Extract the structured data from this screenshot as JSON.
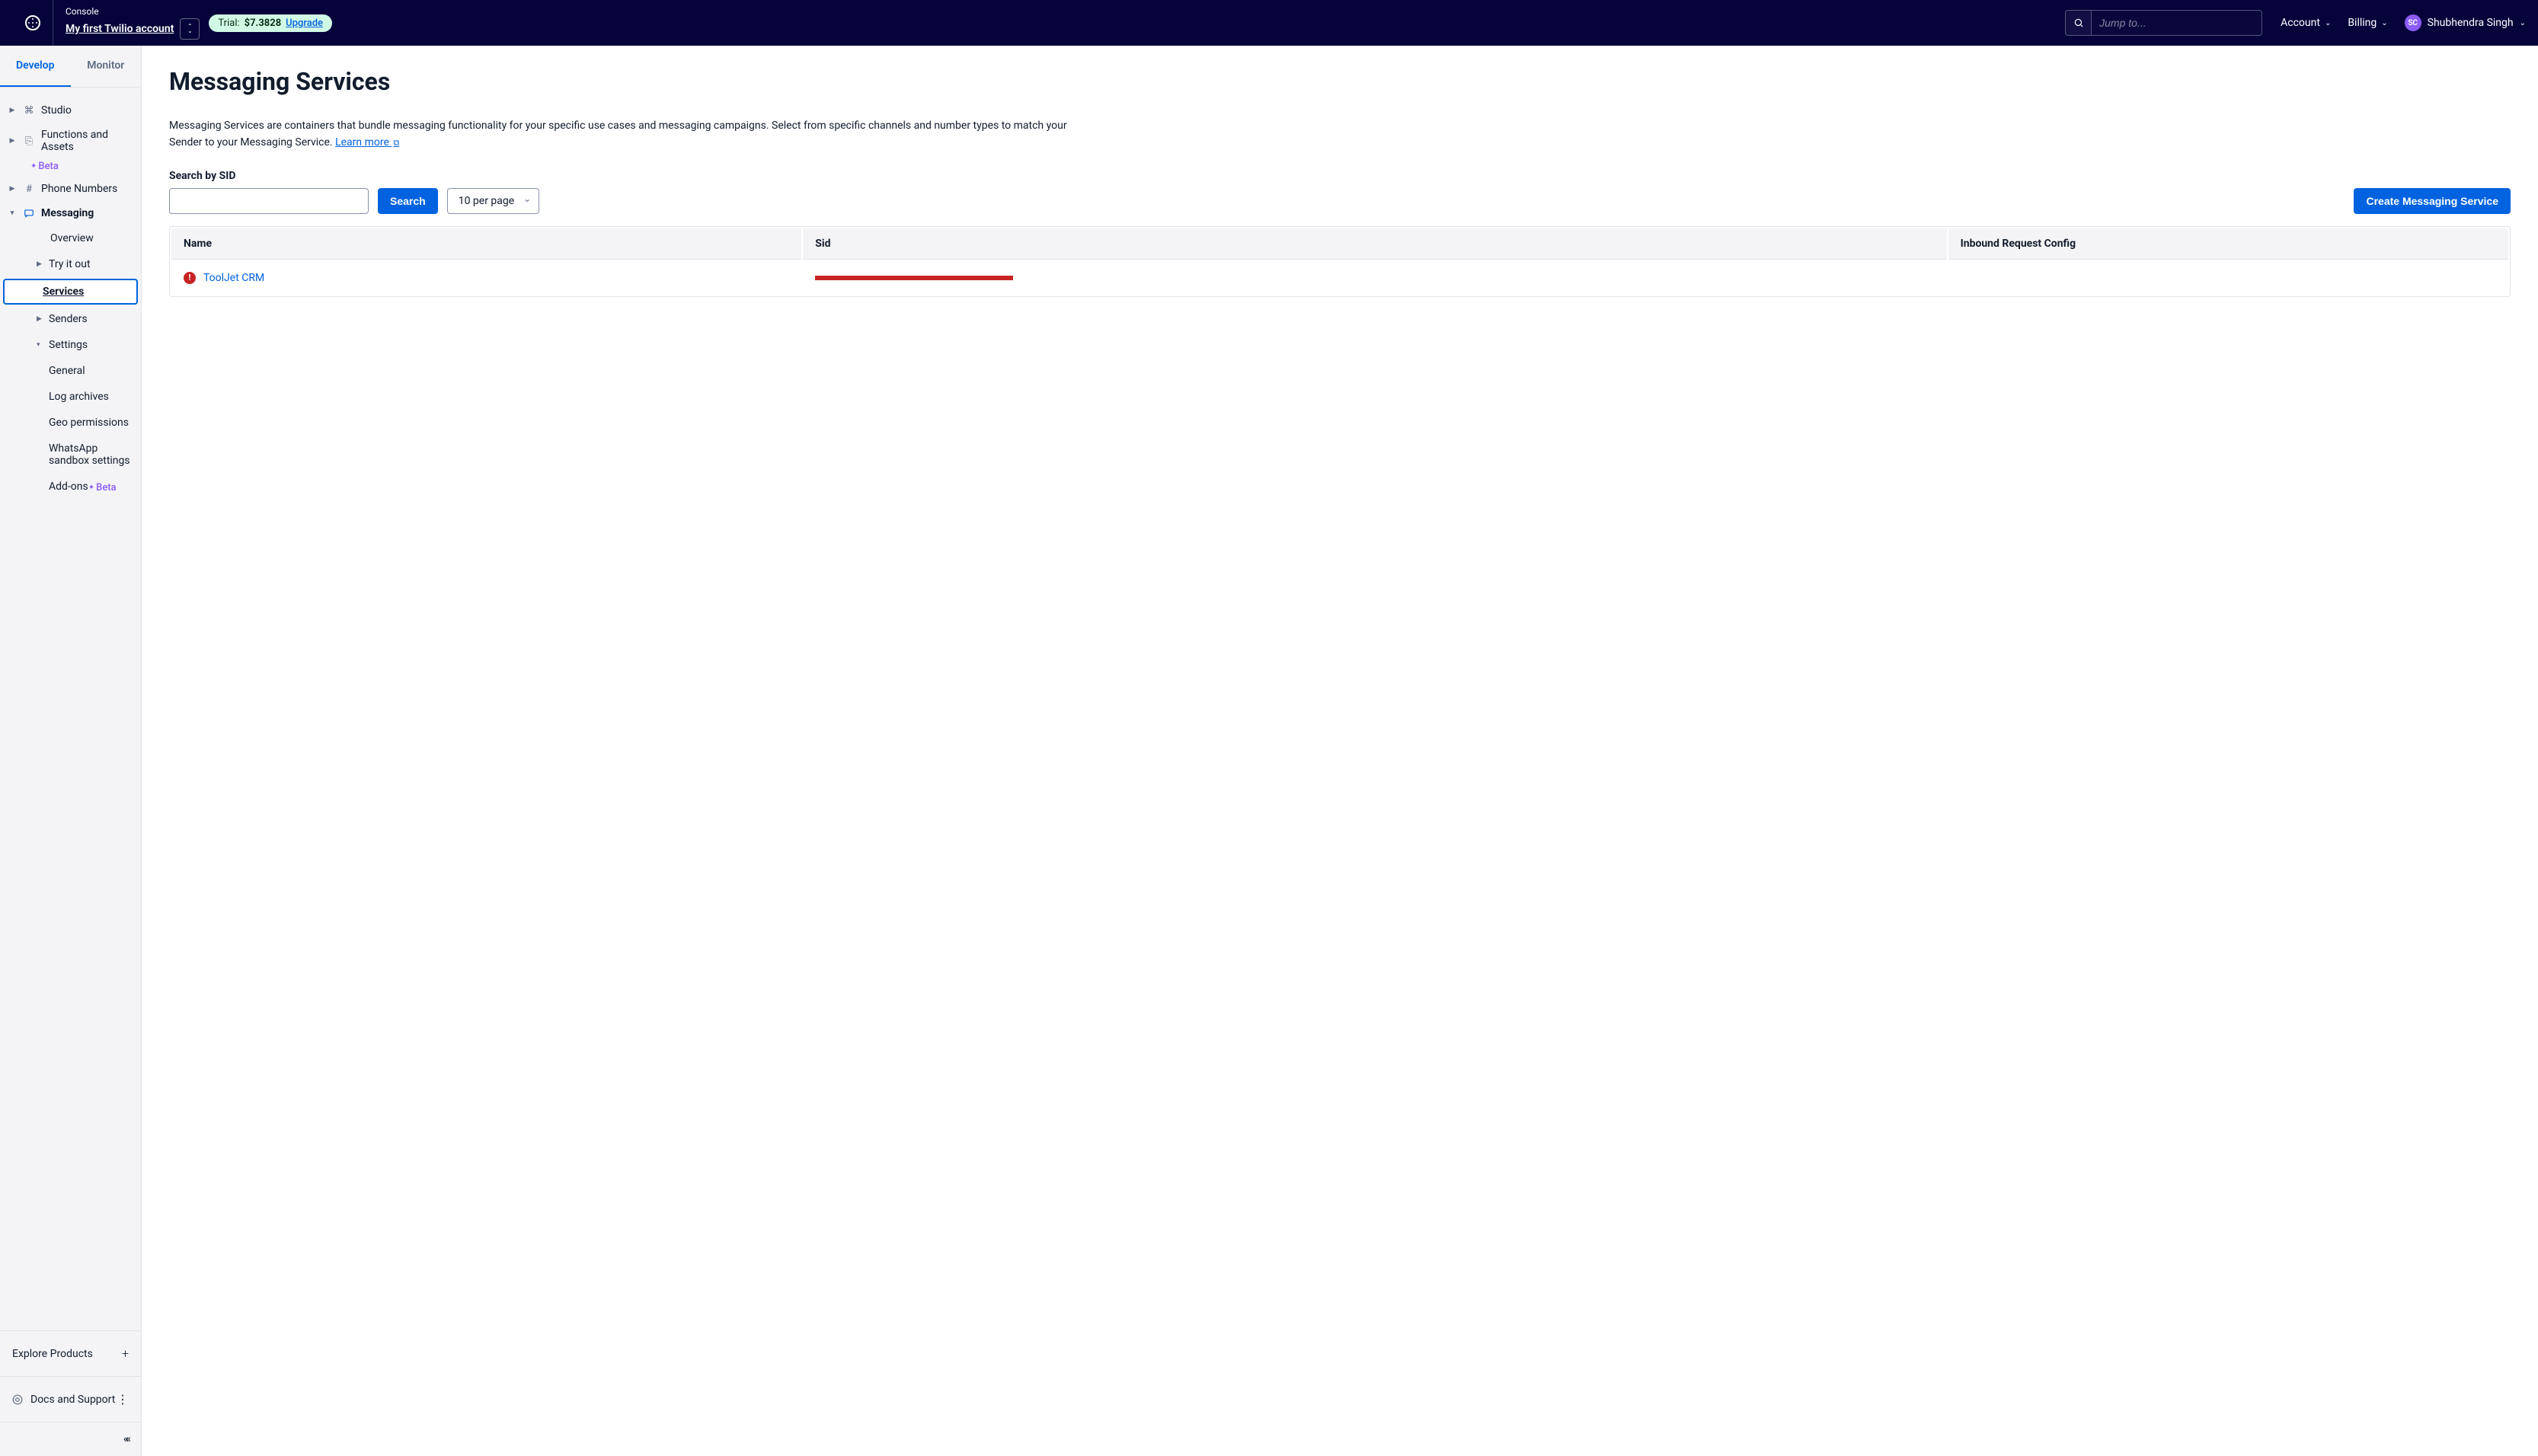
{
  "header": {
    "console_label": "Console",
    "account_name": "My first Twilio account",
    "trial_prefix": "Trial:",
    "trial_amount": "$7.3828",
    "trial_upgrade": "Upgrade",
    "search_placeholder": "Jump to...",
    "account_link": "Account",
    "billing_link": "Billing",
    "user_initials": "SC",
    "user_name": "Shubhendra Singh"
  },
  "sidebar": {
    "tabs": {
      "develop": "Develop",
      "monitor": "Monitor"
    },
    "items": {
      "studio": "Studio",
      "functions": "Functions and Assets",
      "functions_beta": "Beta",
      "phone": "Phone Numbers",
      "messaging": "Messaging",
      "overview": "Overview",
      "tryit": "Try it out",
      "services": "Services",
      "senders": "Senders",
      "settings": "Settings",
      "general": "General",
      "logarchives": "Log archives",
      "geoperm": "Geo permissions",
      "whatsapp": "WhatsApp sandbox settings",
      "addons": "Add-ons",
      "addons_beta": "Beta"
    },
    "explore": "Explore Products",
    "docs": "Docs and Support"
  },
  "main": {
    "title": "Messaging Services",
    "desc_text": "Messaging Services are containers that bundle messaging functionality for your specific use cases and messaging campaigns. Select from specific channels and number types to match your Sender to your Messaging Service. ",
    "learn_more": "Learn more",
    "search_label": "Search by SID",
    "search_btn": "Search",
    "per_page": "10 per page",
    "create_btn": "Create Messaging Service",
    "cols": {
      "name": "Name",
      "sid": "Sid",
      "inbound": "Inbound Request Config"
    },
    "rows": [
      {
        "name": "ToolJet CRM",
        "sid_redacted": true,
        "inbound": ""
      }
    ]
  }
}
